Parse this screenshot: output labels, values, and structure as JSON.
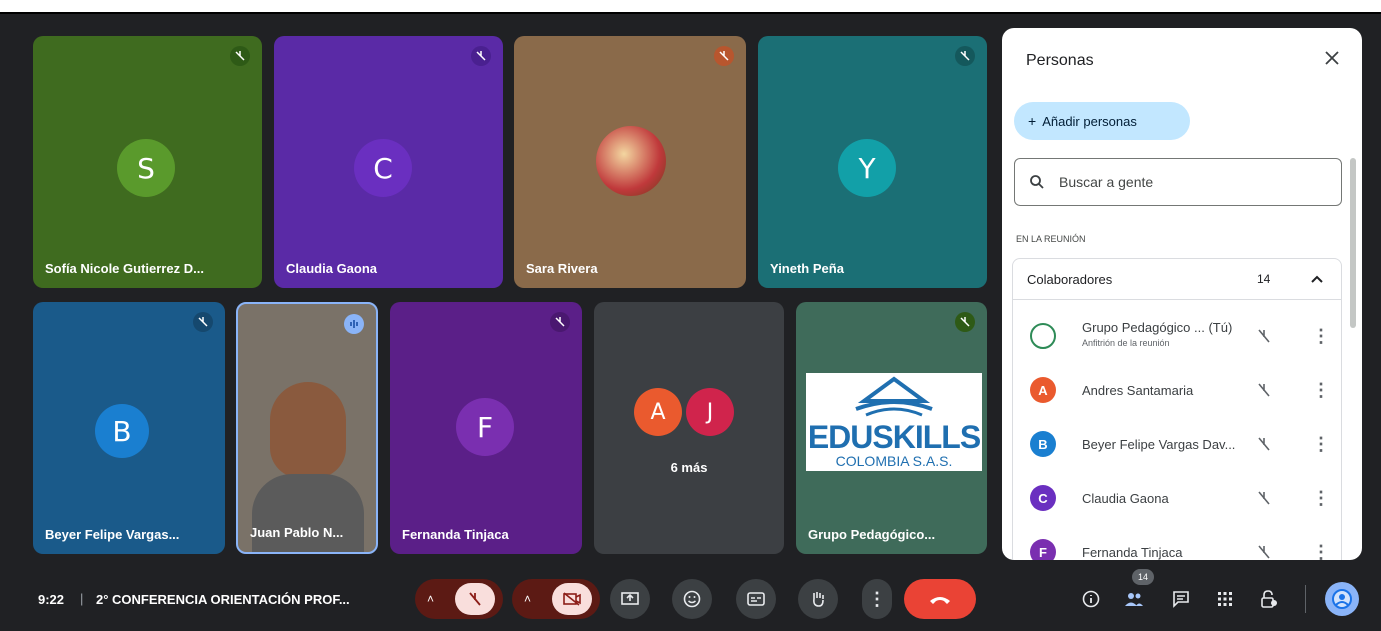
{
  "meeting": {
    "time": "9:22",
    "separator": "|",
    "title": "2° CONFERENCIA ORIENTACIÓN PROF..."
  },
  "tiles": [
    {
      "name": "Sofía Nicole Gutierrez D...",
      "initial": "S",
      "bg": "#3f6b1f",
      "avatar": "#5a9a2c",
      "mute_icon": "mic-off-icon"
    },
    {
      "name": "Claudia Gaona",
      "initial": "C",
      "bg": "#5a2aa6",
      "avatar": "#6a2fc0",
      "mute_icon": "mic-off-icon"
    },
    {
      "name": "Sara Rivera",
      "initial": "",
      "bg": "#8a6a4a",
      "avatar": "#c0393b",
      "mute_icon": "mic-off-icon"
    },
    {
      "name": "Yineth Peña",
      "initial": "Y",
      "bg": "#1b6f75",
      "avatar": "#12a0a8",
      "mute_icon": "mic-off-icon"
    },
    {
      "name": "Beyer Felipe Vargas...",
      "initial": "B",
      "bg": "#1a5a8a",
      "avatar": "#1a7fd0",
      "mute_icon": "mic-off-icon"
    },
    {
      "name": "Juan Pablo N...",
      "initial": "",
      "bg": "#7a7268",
      "avatar": "",
      "mute_icon": "speaking-icon"
    },
    {
      "name": "Fernanda Tinjaca",
      "initial": "F",
      "bg": "#5b1f88",
      "avatar": "#7a2fb0",
      "mute_icon": "mic-off-icon"
    },
    {
      "name": "",
      "initial": "",
      "bg": "#3c3f43",
      "avatar": "",
      "mute_icon": ""
    },
    {
      "name": "Grupo Pedagógico...",
      "initial": "",
      "bg": "#3f6b5a",
      "avatar": "",
      "mute_icon": "mic-off-icon"
    }
  ],
  "overflow_tile": {
    "initials": [
      "A",
      "J"
    ],
    "colors": [
      "#ea5a2e",
      "#d0244c"
    ],
    "label": "6 más"
  },
  "logo": {
    "line1": "EDUSKILLS",
    "line2": "COLOMBIA S.A.S.",
    "color": "#1f6fb0"
  },
  "panel": {
    "title": "Personas",
    "add_button": "Añadir personas",
    "search_placeholder": "Buscar a gente",
    "section": "EN LA REUNIÓN",
    "group": {
      "label": "Colaboradores",
      "count": "14"
    },
    "people": [
      {
        "name": "Grupo Pedagógico ... (Tú)",
        "subtitle": "Anfitrión de la reunión",
        "initial": "",
        "color": "#2e8b57"
      },
      {
        "name": "Andres Santamaria",
        "subtitle": "",
        "initial": "A",
        "color": "#ea5a2e"
      },
      {
        "name": "Beyer Felipe Vargas Dav...",
        "subtitle": "",
        "initial": "B",
        "color": "#1a7fd0"
      },
      {
        "name": "Claudia Gaona",
        "subtitle": "",
        "initial": "C",
        "color": "#6a2fc0"
      },
      {
        "name": "Fernanda Tinjaca",
        "subtitle": "",
        "initial": "F",
        "color": "#7a2fb0"
      }
    ]
  },
  "toolbar": {
    "participant_count": "14",
    "buttons": [
      "mic-off-icon",
      "camera-off-icon",
      "present-icon",
      "emoji-icon",
      "captions-icon",
      "raise-hand-icon",
      "more-icon",
      "end-call-icon"
    ],
    "right_buttons": [
      "info-icon",
      "people-icon",
      "chat-icon",
      "activities-icon",
      "host-controls-icon",
      "avatar-icon"
    ]
  },
  "colors": {
    "mute_red": "#5c1a14",
    "mute_red_light": "#f9dedc",
    "end_call": "#ea4335",
    "panel_pill": "#c2e7ff"
  }
}
